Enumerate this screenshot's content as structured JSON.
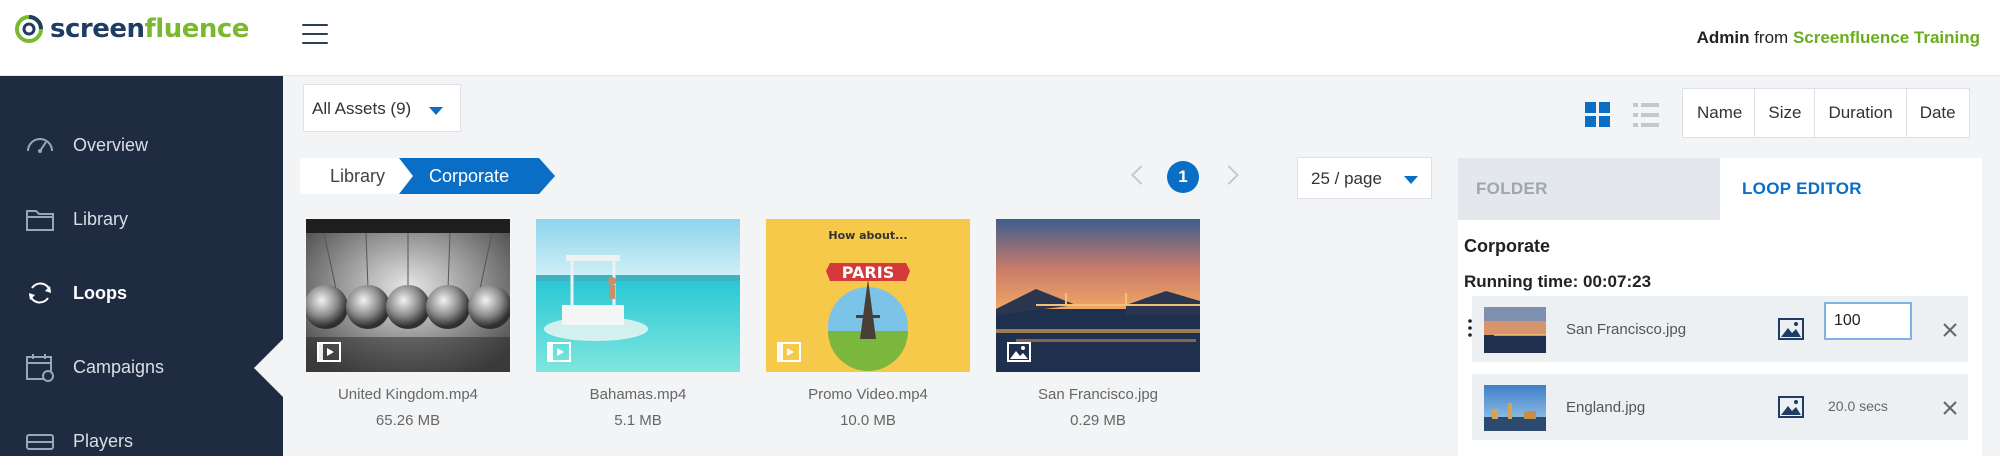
{
  "brand": {
    "part1": "screen",
    "part2": "fluence"
  },
  "header": {
    "user": "Admin",
    "from": "from",
    "org": "Screenfluence Training"
  },
  "sidebar": {
    "items": [
      {
        "label": "Overview",
        "icon": "gauge-icon"
      },
      {
        "label": "Library",
        "icon": "folder-icon"
      },
      {
        "label": "Loops",
        "icon": "loop-arrows-icon",
        "active": true
      },
      {
        "label": "Campaigns",
        "icon": "calendar-icon"
      },
      {
        "label": "Players",
        "icon": "player-icon"
      }
    ]
  },
  "toolbar": {
    "assets_filter": "All Assets (9)",
    "sort_options": [
      "Name",
      "Size",
      "Duration",
      "Date"
    ]
  },
  "breadcrumb": {
    "root": "Library",
    "current": "Corporate"
  },
  "pagination": {
    "current_page": "1",
    "per_page": "25 / page"
  },
  "assets": [
    {
      "name": "United Kingdom.mp4",
      "size": "65.26 MB",
      "type": "video"
    },
    {
      "name": "Bahamas.mp4",
      "size": "5.1 MB",
      "type": "video"
    },
    {
      "name": "Promo Video.mp4",
      "size": "10.0 MB",
      "type": "video",
      "thumb_text_1": "How about...",
      "thumb_text_2": "PARIS"
    },
    {
      "name": "San Francisco.jpg",
      "size": "0.29 MB",
      "type": "image"
    }
  ],
  "panel": {
    "tabs": {
      "folder": "FOLDER",
      "loop_editor": "LOOP EDITOR"
    },
    "title": "Corporate",
    "running_time": "Running time: 00:07:23",
    "items": [
      {
        "name": "San Francisco.jpg",
        "duration_input": "100"
      },
      {
        "name": "England.jpg",
        "duration": "20.0 secs"
      }
    ]
  },
  "colors": {
    "accent": "#0a6ec7",
    "brand_green": "#7ab92e",
    "sidebar": "#1f2b40"
  }
}
